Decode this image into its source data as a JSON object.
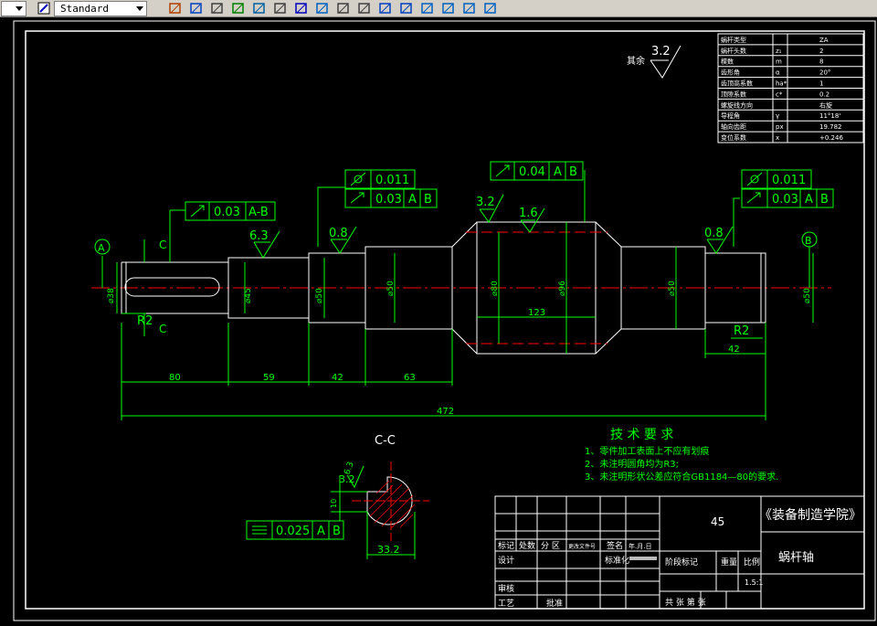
{
  "toolbar": {
    "style_dropdown": "Standard",
    "icons": [
      "layer-icon",
      "text-style-icon",
      "edit-icon",
      "dimension-icon",
      "mirror-icon",
      "hatch-icon",
      "array-icon",
      "move-icon",
      "rotate-icon",
      "scale-icon",
      "stretch-icon",
      "trim-icon",
      "extend-icon",
      "break-icon",
      "chamfer-icon",
      "fillet-icon",
      "explode-icon",
      "properties-icon"
    ]
  },
  "drawing": {
    "roughness_other_label": "其余",
    "roughness_other_value": "3.2",
    "param_table": [
      [
        "蜗杆类型",
        "",
        "ZA"
      ],
      [
        "蜗杆头数",
        "z₁",
        "2"
      ],
      [
        "模数",
        "m",
        "8"
      ],
      [
        "齿形角",
        "α",
        "20°"
      ],
      [
        "齿顶高系数",
        "ha*",
        "1"
      ],
      [
        "顶隙系数",
        "c*",
        "0.2"
      ],
      [
        "螺旋线方向",
        "",
        "右旋"
      ],
      [
        "导程角",
        "γ",
        "11°18'"
      ],
      [
        "轴向齿距",
        "px",
        "19.782"
      ],
      [
        "变位系数",
        "x",
        "+0.246"
      ]
    ],
    "tol_left_runout": "0.03",
    "tol_left_datum": "A-B",
    "tol_left_cyl": "0.011",
    "tol_left_run2": "0.03",
    "tol_left_da": "A",
    "tol_left_db": "B",
    "tol_mid_run": "0.04",
    "tol_mid_da": "A",
    "tol_mid_db": "B",
    "tol_right_cyl": "0.011",
    "tol_right_run": "0.03",
    "tol_right_da": "A",
    "tol_right_db": "B",
    "rough_63": "6.3",
    "rough_08_left": "0.8",
    "rough_32": "3.2",
    "rough_16": "1.6",
    "rough_08_right": "0.8",
    "datum_a": "A",
    "datum_b": "B",
    "section_c_top": "C",
    "section_c_bottom": "C",
    "radius_left": "R2",
    "radius_right": "R2",
    "dia_38": "⌀38",
    "dia_45": "⌀45",
    "dia_50_a": "⌀50",
    "dia_50_b": "⌀50",
    "dia_80": "⌀80",
    "dia_96": "⌀96",
    "dia_50_c": "⌀50",
    "dia_50_d": "⌀50",
    "len_123": "123",
    "len_80": "80",
    "len_59": "59",
    "len_42a": "42",
    "len_63": "63",
    "len_42b": "42",
    "len_472": "472",
    "tech_title": "技 术 要 求",
    "tech_1": "1、零件加工表面上不应有划痕",
    "tech_2": "2、未注明圆角均为R3;",
    "tech_3": "3、未注明形状公差应符合GB1184—80的要求.",
    "section_title": "C-C",
    "sec_rough1": "3.2",
    "sec_rough2": "6.3",
    "sec_sym_value": "0.025",
    "sec_sym_a": "A",
    "sec_sym_b": "B",
    "sec_dim": "33.2",
    "sec_key_dim": "10"
  },
  "title_block": {
    "material": "45",
    "school": "《装备制造学院》",
    "part_name": "蜗杆轴",
    "scale": "1.5:1",
    "row_mark": [
      "标记",
      "处数",
      "分 区",
      "更改文件号",
      "签名",
      "年.月.日"
    ],
    "design": "设计",
    "standard": "标准化",
    "stage": "阶段标记",
    "weight": "重量",
    "ratio": "比例",
    "review": "审核",
    "process": "工艺",
    "approve": "批准",
    "sheets": "共  张  第  张"
  }
}
